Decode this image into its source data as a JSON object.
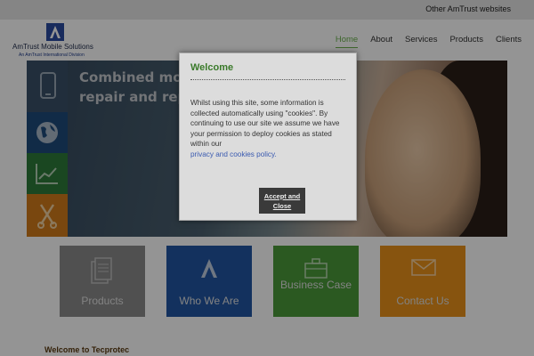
{
  "topbar": {
    "other_sites": "Other AmTrust websites"
  },
  "logo": {
    "brand": "AmTrust Mobile Solutions",
    "tagline": "An AmTrust International Division"
  },
  "nav": {
    "items": [
      "Home",
      "About",
      "Services",
      "Products",
      "Clients"
    ],
    "active": "Home"
  },
  "hero": {
    "headline": "Combined mobile insurance and repair and replacement services"
  },
  "cards": [
    {
      "label": "Products",
      "color": "#8a8a8a",
      "icon": "documents-icon"
    },
    {
      "label": "Who We Are",
      "color": "#2155a3",
      "icon": "amtrust-logo-icon"
    },
    {
      "label": "Business Case",
      "color": "#4a9a3a",
      "icon": "briefcase-icon"
    },
    {
      "label": "Contact Us",
      "color": "#e8921a",
      "icon": "envelope-icon"
    }
  ],
  "welcome_heading": "Welcome to Tecprotec",
  "cookie_modal": {
    "title": "Welcome",
    "message": "Whilst using this site, some information is collected automatically using \"cookies\". By continuing to use our site we assume we have your permission to deploy cookies as stated within our",
    "link": "privacy and cookies policy.",
    "button": "Accept and Close"
  },
  "colors": {
    "accent_green": "#6ab04c",
    "brand_navy": "#1e2a4a"
  }
}
